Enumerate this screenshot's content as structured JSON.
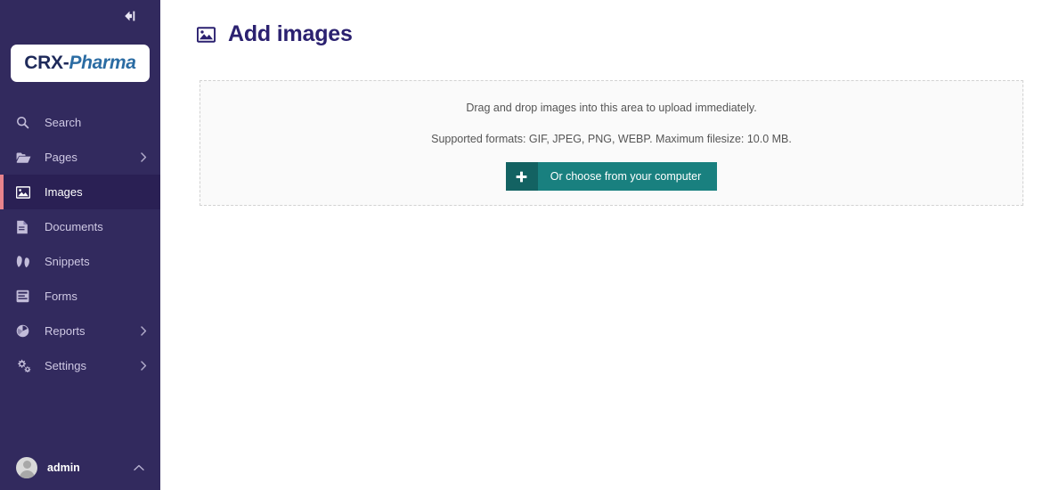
{
  "sidebar": {
    "collapse_icon": "collapse-left-icon",
    "logo": {
      "primary": "CRX-",
      "secondary": "Pharma"
    },
    "items": [
      {
        "label": "Search",
        "icon": "search-icon",
        "active": false,
        "expandable": false
      },
      {
        "label": "Pages",
        "icon": "folder-icon",
        "active": false,
        "expandable": true
      },
      {
        "label": "Images",
        "icon": "image-icon",
        "active": true,
        "expandable": false
      },
      {
        "label": "Documents",
        "icon": "document-icon",
        "active": false,
        "expandable": false
      },
      {
        "label": "Snippets",
        "icon": "puzzle-icon",
        "active": false,
        "expandable": false
      },
      {
        "label": "Forms",
        "icon": "form-icon",
        "active": false,
        "expandable": false
      },
      {
        "label": "Reports",
        "icon": "chart-pie-icon",
        "active": false,
        "expandable": true
      },
      {
        "label": "Settings",
        "icon": "gears-icon",
        "active": false,
        "expandable": true
      }
    ],
    "user": {
      "name": "admin",
      "avatar_icon": "user-avatar-icon",
      "chevron_icon": "chevron-up-icon"
    },
    "colors": {
      "background": "#322a5e",
      "active_background": "#2a2054",
      "active_marker": "#e8838c",
      "label": "#cfc9e4"
    }
  },
  "main": {
    "header": {
      "icon": "image-icon",
      "title": "Add images",
      "title_color": "#2b2170"
    },
    "dropzone": {
      "line1": "Drag and drop images into this area to upload immediately.",
      "line2": "Supported formats: GIF, JPEG, PNG, WEBP. Maximum filesize: 10.0 MB.",
      "button": {
        "icon": "plus-icon",
        "label": "Or choose from your computer",
        "icon_background": "#136262",
        "background": "#19807f"
      },
      "border_color": "#d2d2d2",
      "background": "#fafafa"
    }
  }
}
